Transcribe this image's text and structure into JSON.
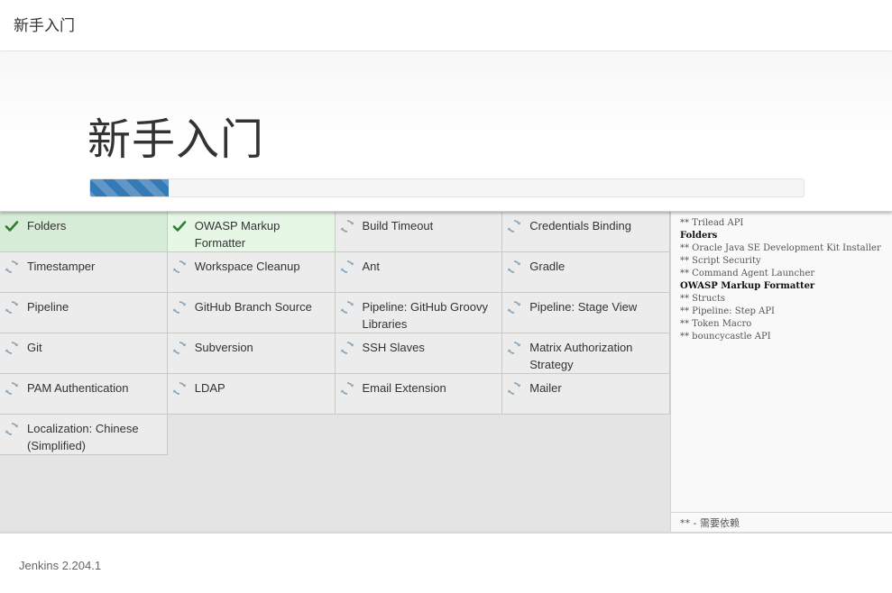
{
  "header": {
    "title": "新手入门"
  },
  "hero": {
    "heading": "新手入门",
    "progress": 0.11
  },
  "colors": {
    "accent": "#337ab7",
    "success": "#2e7d32",
    "pending_icon": "#8aa4b8"
  },
  "plugins": [
    {
      "name": "Folders",
      "status": "success"
    },
    {
      "name": "OWASP Markup Formatter",
      "status": "success-light"
    },
    {
      "name": "Build Timeout",
      "status": "pending"
    },
    {
      "name": "Credentials Binding",
      "status": "pending"
    },
    {
      "name": "Timestamper",
      "status": "pending"
    },
    {
      "name": "Workspace Cleanup",
      "status": "pending"
    },
    {
      "name": "Ant",
      "status": "pending"
    },
    {
      "name": "Gradle",
      "status": "pending"
    },
    {
      "name": "Pipeline",
      "status": "pending"
    },
    {
      "name": "GitHub Branch Source",
      "status": "pending"
    },
    {
      "name": "Pipeline: GitHub Groovy Libraries",
      "status": "pending"
    },
    {
      "name": "Pipeline: Stage View",
      "status": "pending"
    },
    {
      "name": "Git",
      "status": "pending"
    },
    {
      "name": "Subversion",
      "status": "pending"
    },
    {
      "name": "SSH Slaves",
      "status": "pending"
    },
    {
      "name": "Matrix Authorization Strategy",
      "status": "pending"
    },
    {
      "name": "PAM Authentication",
      "status": "pending"
    },
    {
      "name": "LDAP",
      "status": "pending"
    },
    {
      "name": "Email Extension",
      "status": "pending"
    },
    {
      "name": "Mailer",
      "status": "pending"
    },
    {
      "name": "Localization: Chinese (Simplified)",
      "status": "pending"
    }
  ],
  "log": [
    {
      "text": "** Trilead API",
      "bold": false
    },
    {
      "text": "Folders",
      "bold": true
    },
    {
      "text": "** Oracle Java SE Development Kit Installer",
      "bold": false
    },
    {
      "text": "** Script Security",
      "bold": false
    },
    {
      "text": "** Command Agent Launcher",
      "bold": false
    },
    {
      "text": "OWASP Markup Formatter",
      "bold": true
    },
    {
      "text": "** Structs",
      "bold": false
    },
    {
      "text": "** Pipeline: Step API",
      "bold": false
    },
    {
      "text": "** Token Macro",
      "bold": false
    },
    {
      "text": "** bouncycastle API",
      "bold": false
    }
  ],
  "legend": "** - 需要依赖",
  "footer": {
    "version": "Jenkins 2.204.1"
  }
}
